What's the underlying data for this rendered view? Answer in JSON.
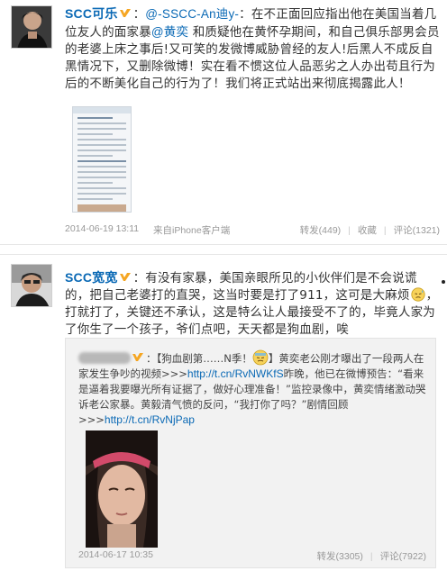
{
  "post1": {
    "author": "SCC可乐",
    "mention": "@-SSCC-An迪y-",
    "text_a": "：在不正面回应指出他在美国当着几位友人的面家暴",
    "mention2": "@黄奕",
    "text_b": " 和质疑他在黄怀孕期间，和自己俱乐部男会员的老婆上床之事后!又可笑的发微博威胁曾经的友人!后黑人不成反自黑情况下，又删除微博！实在看不惯这位人品恶劣之人办出苟且行为后的不断美化自己的行为了！我们将正式站出来彻底揭露此人！",
    "time": "2014-06-19 13:11",
    "source": "来自iPhone客户端",
    "repost_label": "转发(449)",
    "fav_label": "收藏",
    "comment_label": "评论(1321)"
  },
  "post2": {
    "author": "SCC宽宽",
    "text": "：有没有家暴，美国亲眼所见的小伙伴们是不会说谎的，把自己老婆打的直哭，这当时要是打了911，这可是大麻烦",
    "text_b": "，打就打了，关键还不承认，这是特么让人最接受不了的，毕竟人家为了你生了一个孩子，爷们点吧，天天都是狗血剧，唉",
    "repost": {
      "title": "：【狗血剧第……N季！",
      "text_a": "】黄奕老公刚才曝出了一段两人在家发生争吵的视频>>>",
      "link1": "http://t.cn/RvNWKfS",
      "text_b": "昨晚，他已在微博预告：“看来是逼着我要曝光所有证据了，做好心理准备！”监控录像中，黄奕情绪激动哭诉老公家暴。黄毅清气愤的反问，“我打你了吗？”剧情回顾>>>",
      "link2": "http://t.cn/RvNjPap",
      "time": "2014-06-17 10:35",
      "repost_label": "转发(3305)",
      "comment_label": "评论(7922)"
    }
  },
  "colors": {
    "link": "#0a69b5",
    "meta": "#999999"
  }
}
